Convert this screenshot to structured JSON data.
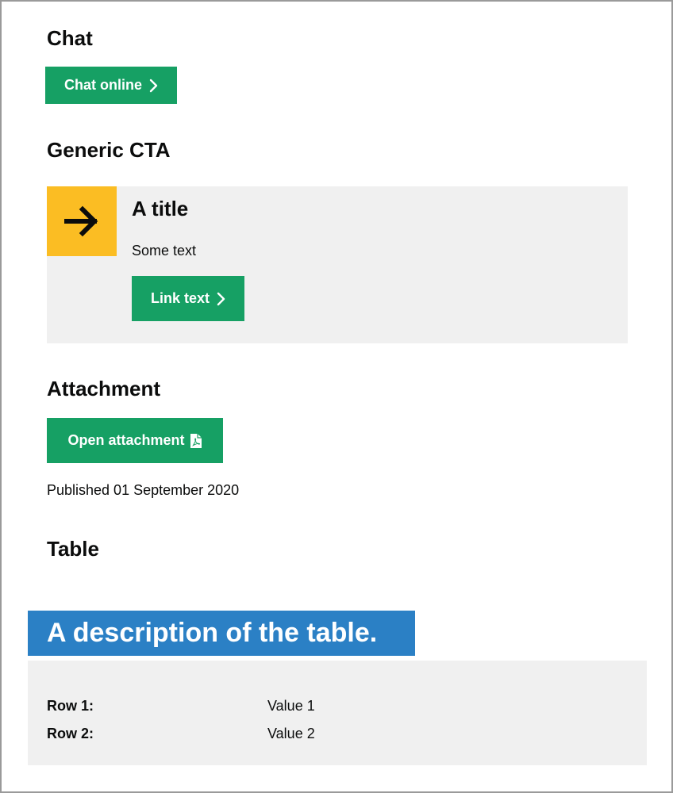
{
  "sections": {
    "chat": {
      "heading": "Chat",
      "button_label": "Chat online"
    },
    "generic_cta": {
      "heading": "Generic CTA",
      "icon": "arrow-right-icon",
      "title": "A title",
      "text": "Some text",
      "link_label": "Link text"
    },
    "attachment": {
      "heading": "Attachment",
      "button_label": "Open attachment",
      "icon": "pdf-file-icon",
      "published": "Published 01 September 2020"
    },
    "table": {
      "heading": "Table",
      "caption": "A description of the table.",
      "rows": [
        {
          "label": "Row 1:",
          "value": "Value 1"
        },
        {
          "label": "Row 2:",
          "value": "Value 2"
        }
      ]
    }
  },
  "colors": {
    "button_green": "#16a064",
    "cta_icon_yellow": "#fbbd23",
    "caption_blue": "#2b80c5",
    "panel_grey": "#f0f0f0"
  }
}
